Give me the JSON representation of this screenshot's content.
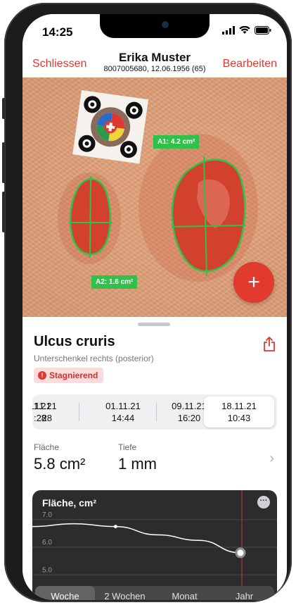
{
  "status": {
    "time": "14:25"
  },
  "nav": {
    "left": "Schliessen",
    "title": "Erika Muster",
    "subtitle": "8007005680, 12.06.1956 (65)",
    "right": "Bearbeiten"
  },
  "wounds": [
    {
      "label": "A1: 4.2 cm²"
    },
    {
      "label": "A2: 1.6 cm²"
    }
  ],
  "sheet": {
    "title": "Ulcus cruris",
    "subtitle": "Unterschenkel rechts (posterior)",
    "badge": "Stagnierend",
    "dates": [
      {
        "date": "11.21",
        "time": ":28"
      },
      {
        "date": "01.11.21",
        "time": "14:44"
      },
      {
        "date": "09.11.21",
        "time": "16:20"
      },
      {
        "date": "18.11.21",
        "time": "10:43"
      }
    ],
    "area_label": "Fläche",
    "area_value": "5.8 cm²",
    "depth_label": "Tiefe",
    "depth_value": "1 mm"
  },
  "chart_data": {
    "type": "line",
    "title": "Fläche, cm²",
    "yticks": [
      "7.0",
      "6.0",
      "5.0"
    ],
    "ylim": [
      4.6,
      7.3
    ],
    "series": [
      {
        "values": [
          6.75,
          6.85,
          6.75,
          6.45,
          6.25,
          5.8
        ]
      }
    ],
    "highlight_point": 5.8,
    "grid": true
  },
  "segments": [
    "Woche",
    "2 Wochen",
    "Monat",
    "Jahr"
  ],
  "colors": {
    "accent": "#e0382e",
    "outline": "#2fc14a"
  }
}
